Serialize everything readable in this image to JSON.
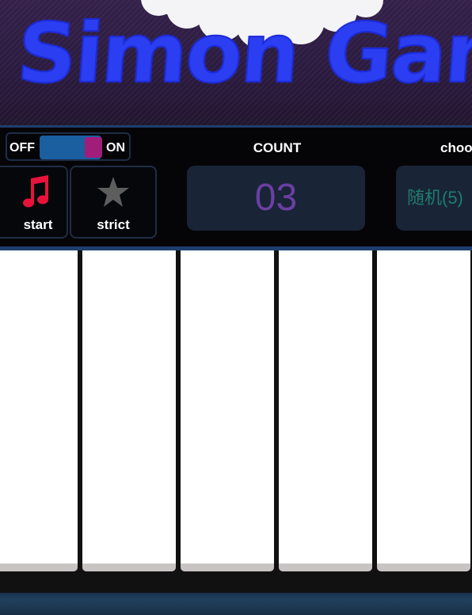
{
  "header": {
    "title": "Simon Game"
  },
  "controls": {
    "power": {
      "off_label": "OFF",
      "on_label": "ON",
      "state": "on"
    },
    "count_label": "COUNT",
    "choose_label": "choo",
    "count_value": "03",
    "choose_value": "随机(5)"
  },
  "buttons": {
    "start": {
      "label": "start",
      "icon": "music-note-icon",
      "icon_color": "#e8133a"
    },
    "strict": {
      "label": "strict",
      "icon": "star-icon",
      "icon_color": "#5d5d5d"
    }
  },
  "keyboard": {
    "key_count": 5
  },
  "colors": {
    "title": "#2b3ef2",
    "toggle_track": "#1b5fa1",
    "toggle_knob": "#a11d7a",
    "count_text": "#6b3fa2",
    "choose_text": "#1f7d6d",
    "panel": "#192437"
  }
}
